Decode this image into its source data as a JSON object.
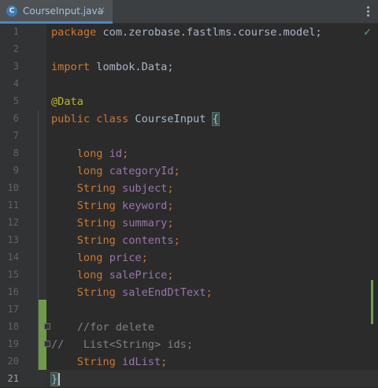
{
  "tab": {
    "icon_letter": "C",
    "label": "CourseInput.java",
    "close": "✕"
  },
  "status": {
    "analysis_icon": "check-icon",
    "check_glyph": "✓"
  },
  "line_numbers": [
    "1",
    "2",
    "3",
    "4",
    "5",
    "6",
    "7",
    "8",
    "9",
    "10",
    "11",
    "12",
    "13",
    "14",
    "15",
    "16",
    "17",
    "18",
    "19",
    "20",
    "21"
  ],
  "code": {
    "l1": {
      "kw": "package",
      "rest": " com.zerobase.fastlms.course.model;"
    },
    "l3": {
      "kw": "import",
      "rest": " lombok.Data;"
    },
    "l5": {
      "anno": "@Data"
    },
    "l6": {
      "kw1": "public",
      "kw2": " class",
      "rest": " CourseInput ",
      "brace": "{"
    },
    "l8": {
      "type": "long",
      "field": "id",
      "end": ";"
    },
    "l9": {
      "type": "long",
      "field": "categoryId",
      "end": ";"
    },
    "l10": {
      "type": "String",
      "field": "subject",
      "end": ";"
    },
    "l11": {
      "type": "String",
      "field": "keyword",
      "end": ";"
    },
    "l12": {
      "type": "String",
      "field": "summary",
      "end": ";"
    },
    "l13": {
      "type": "String",
      "field": "contents",
      "end": ";"
    },
    "l14": {
      "type": "long",
      "field": "price",
      "end": ";"
    },
    "l15": {
      "type": "long",
      "field": "salePrice",
      "end": ";"
    },
    "l16": {
      "type": "String",
      "field": "saleEndDtText",
      "end": ";"
    },
    "l18": {
      "comment": "    //for delete"
    },
    "l19": {
      "comment": "//   List<String> ids;"
    },
    "l20": {
      "type": "String",
      "field": "idList",
      "end": ";"
    },
    "l21": {
      "brace": "}"
    }
  },
  "colors": {
    "keyword": "#cc7832",
    "field": "#9876aa",
    "annotation": "#bbb529",
    "comment": "#808080",
    "text": "#a9b7c6",
    "change": "#6f9a4a"
  }
}
